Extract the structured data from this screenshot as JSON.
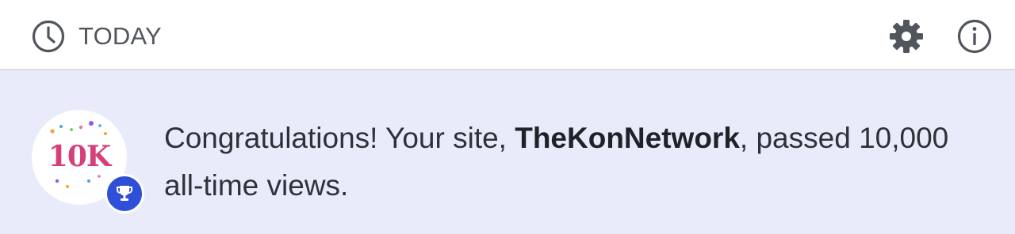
{
  "header": {
    "title": "TODAY",
    "clock_icon": "clock-icon",
    "settings_icon": "gear-icon",
    "info_icon": "info-icon"
  },
  "notification": {
    "badge": {
      "text": "10K",
      "icon": "trophy-icon",
      "text_color": "#d6407a",
      "icon_bg_color": "#2f4fd9"
    },
    "message_prefix": "Congratulations! Your site, ",
    "site_name": "TheKonNetwork",
    "message_suffix": ", passed 10,000 all-time views."
  },
  "colors": {
    "panel_bg": "#e9ebfb",
    "header_bg": "#ffffff",
    "icon_gray": "#51555c",
    "text": "#2c3338"
  }
}
